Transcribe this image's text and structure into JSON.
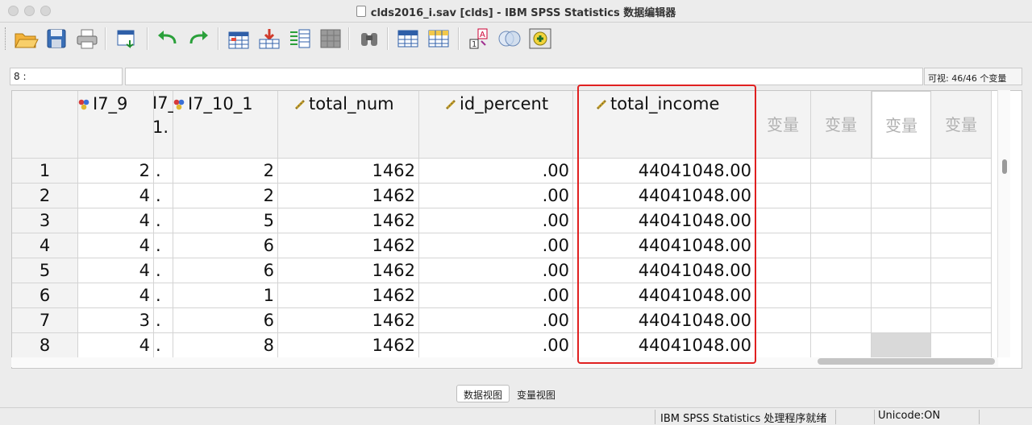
{
  "window": {
    "title": "clds2016_i.sav [clds] - IBM SPSS Statistics 数据编辑器"
  },
  "toolbar": {
    "buttons": [
      "open-icon",
      "save-icon",
      "print-icon",
      "dialog-recall-icon",
      "undo-icon",
      "redo-icon",
      "goto-case-icon",
      "goto-variable-icon",
      "variables-icon",
      "run-descriptives-icon",
      "find-icon",
      "insert-cases-icon",
      "insert-variable-icon",
      "split-file-icon",
      "weight-cases-icon",
      "select-cases-icon",
      "value-labels-icon",
      "use-sets-icon"
    ]
  },
  "editbar": {
    "cell_ref": "8 :",
    "cell_value": "",
    "visible": "可视: 46/46 个变量"
  },
  "grid": {
    "columns": [
      {
        "name": "I7_9",
        "type": "nominal"
      },
      {
        "name": "I7_\n1.",
        "type": "none"
      },
      {
        "name": "I7_10_1",
        "type": "nominal"
      },
      {
        "name": "total_num",
        "type": "scale"
      },
      {
        "name": "id_percent",
        "type": "scale"
      },
      {
        "name": "total_income",
        "type": "scale"
      },
      {
        "name": "变量",
        "type": "empty"
      },
      {
        "name": "变量",
        "type": "empty"
      },
      {
        "name": "变量",
        "type": "empty"
      },
      {
        "name": "变量",
        "type": "empty"
      }
    ],
    "rows": [
      {
        "n": "1",
        "values": [
          "2",
          ".",
          "2",
          "1462",
          ".00",
          "44041048.00"
        ]
      },
      {
        "n": "2",
        "values": [
          "4",
          ".",
          "2",
          "1462",
          ".00",
          "44041048.00"
        ]
      },
      {
        "n": "3",
        "values": [
          "4",
          ".",
          "5",
          "1462",
          ".00",
          "44041048.00"
        ]
      },
      {
        "n": "4",
        "values": [
          "4",
          ".",
          "6",
          "1462",
          ".00",
          "44041048.00"
        ]
      },
      {
        "n": "5",
        "values": [
          "4",
          ".",
          "6",
          "1462",
          ".00",
          "44041048.00"
        ]
      },
      {
        "n": "6",
        "values": [
          "4",
          ".",
          "1",
          "1462",
          ".00",
          "44041048.00"
        ]
      },
      {
        "n": "7",
        "values": [
          "3",
          ".",
          "6",
          "1462",
          ".00",
          "44041048.00"
        ]
      },
      {
        "n": "8",
        "values": [
          "4",
          ".",
          "8",
          "1462",
          ".00",
          "44041048.00"
        ]
      }
    ],
    "highlight_color": "#e02020"
  },
  "tabs": {
    "data_view": "数据视图",
    "variable_view": "变量视图"
  },
  "status": {
    "processor": "IBM SPSS Statistics 处理程序就绪",
    "unicode": "Unicode:ON"
  }
}
